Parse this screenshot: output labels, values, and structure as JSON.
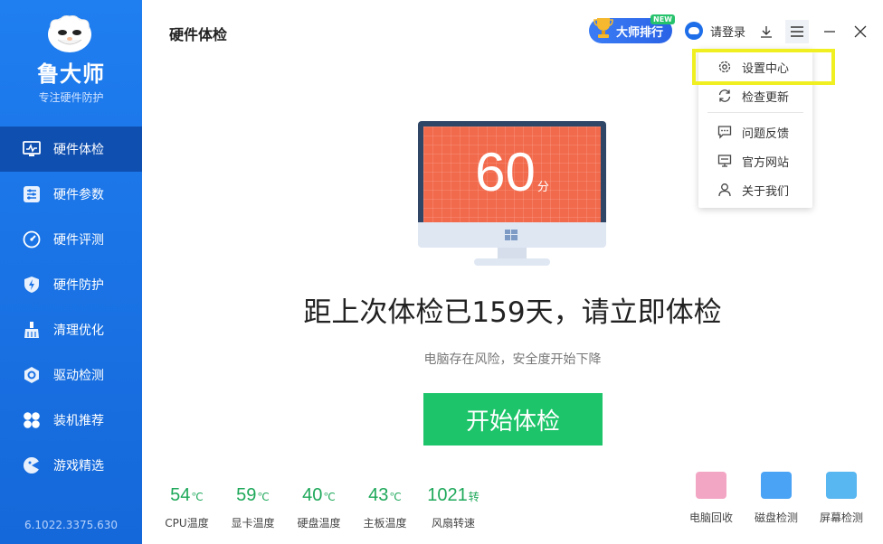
{
  "sidebar": {
    "app_name": "鲁大师",
    "slogan": "专注硬件防护",
    "version": "6.1022.3375.630",
    "items": [
      {
        "label": "硬件体检",
        "icon": "monitor-pulse-icon"
      },
      {
        "label": "硬件参数",
        "icon": "sliders-icon"
      },
      {
        "label": "硬件评测",
        "icon": "speedometer-icon"
      },
      {
        "label": "硬件防护",
        "icon": "shield-bolt-icon"
      },
      {
        "label": "清理优化",
        "icon": "broom-icon"
      },
      {
        "label": "驱动检测",
        "icon": "gear-hex-icon"
      },
      {
        "label": "装机推荐",
        "icon": "grid-petals-icon"
      },
      {
        "label": "游戏精选",
        "icon": "gamepad-icon"
      }
    ]
  },
  "header": {
    "title": "硬件体检",
    "rank_label": "大师排行",
    "new_tag": "NEW",
    "login_label": "请登录"
  },
  "menu": {
    "items": [
      {
        "label": "设置中心",
        "icon": "gear-icon"
      },
      {
        "label": "检查更新",
        "icon": "refresh-icon"
      },
      {
        "label": "问题反馈",
        "icon": "chat-icon"
      },
      {
        "label": "官方网站",
        "icon": "monitor-icon"
      },
      {
        "label": "关于我们",
        "icon": "user-icon"
      }
    ]
  },
  "main": {
    "score": "60",
    "score_unit": "分",
    "headline": "距上次体检已159天，请立即体检",
    "subline": "电脑存在风险，安全度开始下降",
    "start_label": "开始体检"
  },
  "stats": [
    {
      "value": "54",
      "unit": "℃",
      "label": "CPU温度"
    },
    {
      "value": "59",
      "unit": "℃",
      "label": "显卡温度"
    },
    {
      "value": "40",
      "unit": "℃",
      "label": "硬盘温度"
    },
    {
      "value": "43",
      "unit": "℃",
      "label": "主板温度"
    },
    {
      "value": "1021",
      "unit": "转",
      "label": "风扇转速"
    }
  ],
  "tools": [
    {
      "label": "电脑回收",
      "color": "#f3a6c4"
    },
    {
      "label": "磁盘检测",
      "color": "#4aa3f5"
    },
    {
      "label": "屏幕检测",
      "color": "#58b6f0"
    }
  ],
  "colors": {
    "sidebar": "#1f7ef0",
    "active_nav": "#0f4fb0",
    "score_screen": "#f26a4c",
    "start_button": "#1ec46a",
    "stat_value": "#1ea85a",
    "highlight": "#f0ef22"
  }
}
